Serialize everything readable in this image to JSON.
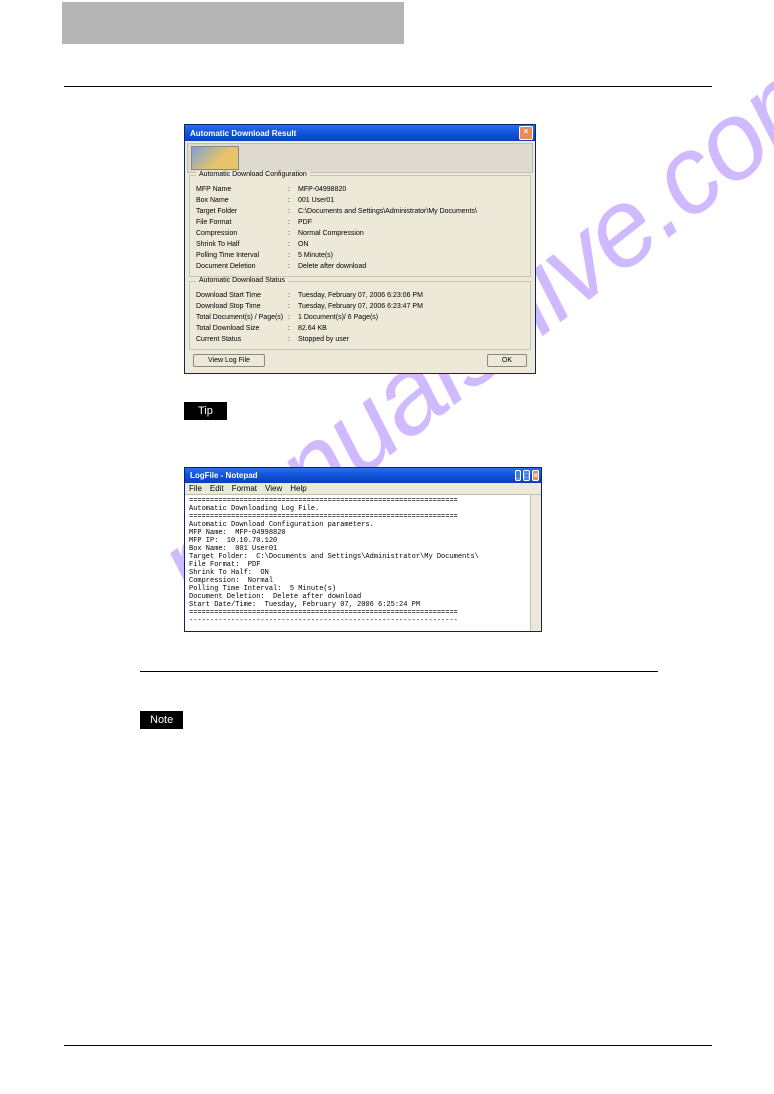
{
  "dialog1": {
    "title": "Automatic Download Result",
    "group1": {
      "legend": "Automatic Download Configuration",
      "rows": [
        {
          "lbl": "MFP Name",
          "val": "MFP-04998820"
        },
        {
          "lbl": "Box Name",
          "val": "001 User01"
        },
        {
          "lbl": "Target Folder",
          "val": "C:\\Documents and Settings\\Administrator\\My Documents\\"
        },
        {
          "lbl": "File Format",
          "val": "PDF"
        },
        {
          "lbl": "Compression",
          "val": "Normal Compression"
        },
        {
          "lbl": "Shrink To Half",
          "val": "ON"
        },
        {
          "lbl": "Polling Time Interval",
          "val": "5 Minute(s)"
        },
        {
          "lbl": "Document Deletion",
          "val": "Delete after download"
        }
      ]
    },
    "group2": {
      "legend": "Automatic Download Status",
      "rows": [
        {
          "lbl": "Download Start Time",
          "val": "Tuesday, February 07, 2006 6:23:06 PM"
        },
        {
          "lbl": "Download Stop Time",
          "val": "Tuesday, February 07, 2006 6:23:47 PM"
        },
        {
          "lbl": "Total Document(s) / Page(s)",
          "val": "1 Document(s)/ 6 Page(s)"
        },
        {
          "lbl": "Total Download Size",
          "val": "82.64 KB"
        },
        {
          "lbl": "Current Status",
          "val": "Stopped by user"
        }
      ]
    },
    "buttons": {
      "viewlog": "View Log File",
      "ok": "OK"
    }
  },
  "tip": "Tip",
  "notepad": {
    "title": "LogFile - Notepad",
    "menu": [
      "File",
      "Edit",
      "Format",
      "View",
      "Help"
    ],
    "content": "================================================================\nAutomatic Downloading Log File.\n================================================================\nAutomatic Download Configuration parameters.\nMFP Name:  MFP-04998820\nMFP IP:  10.10.70.120\nBox Name:  001 User01\nTarget Folder:  C:\\Documents and Settings\\Administrator\\My Documents\\\nFile Format:  PDF\nShrink To Half:  ON\nCompression:  Normal\nPolling Time Interval:  5 Minute(s)\nDocument Deletion:  Delete after download\nStart Date/Time:  Tuesday, February 07, 2006 6:25:24 PM\n================================================================\n----------------------------------------------------------------"
  },
  "note": "Note"
}
